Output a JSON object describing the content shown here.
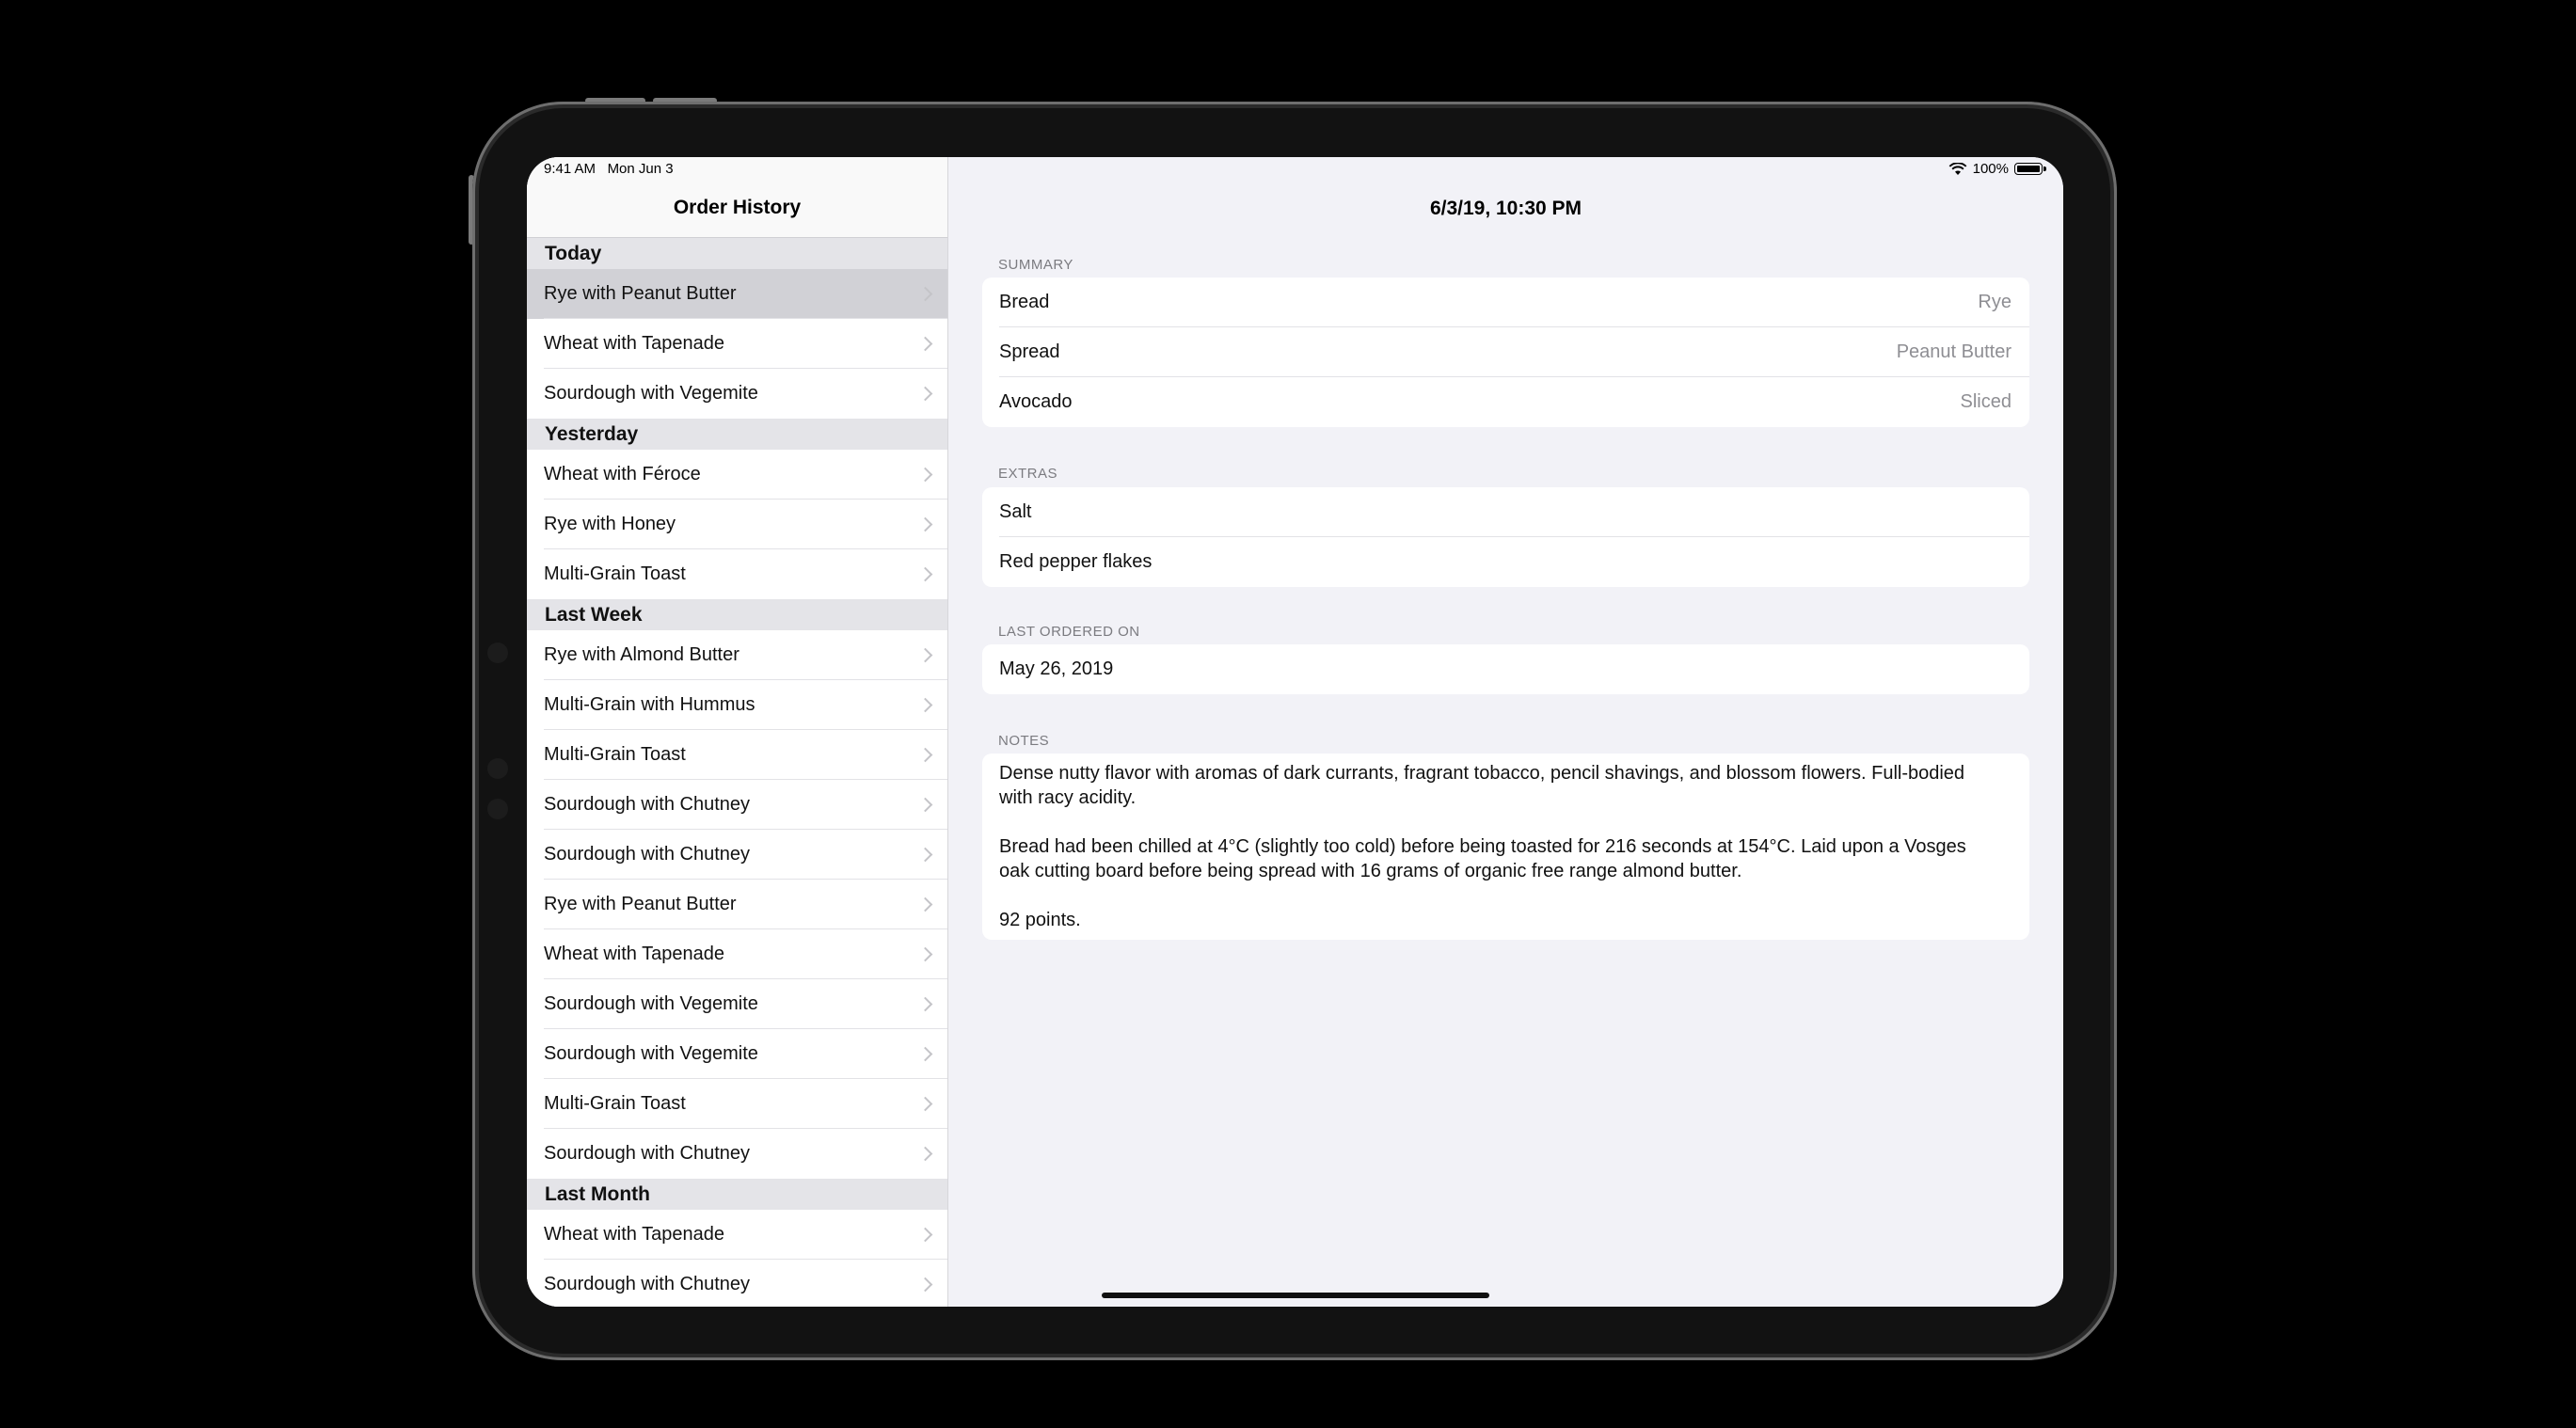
{
  "status": {
    "time": "9:41 AM",
    "date": "Mon Jun 3",
    "battery": "100%"
  },
  "sidebar": {
    "title": "Order History",
    "sections": [
      {
        "header": "Today",
        "items": [
          "Rye with Peanut Butter",
          "Wheat with Tapenade",
          "Sourdough with Vegemite"
        ]
      },
      {
        "header": "Yesterday",
        "items": [
          "Wheat with Féroce",
          "Rye with Honey",
          "Multi-Grain Toast"
        ]
      },
      {
        "header": "Last Week",
        "items": [
          "Rye with Almond Butter",
          "Multi-Grain with Hummus",
          "Multi-Grain Toast",
          "Sourdough with Chutney",
          "Sourdough with Chutney",
          "Rye with Peanut Butter",
          "Wheat with Tapenade",
          "Sourdough with Vegemite",
          "Sourdough with Vegemite",
          "Multi-Grain Toast",
          "Sourdough with Chutney"
        ]
      },
      {
        "header": "Last Month",
        "items": [
          "Wheat with Tapenade",
          "Sourdough with Chutney"
        ]
      }
    ],
    "selected": {
      "section": 0,
      "item": 0
    }
  },
  "detail": {
    "title": "6/3/19, 10:30 PM",
    "summary": {
      "label": "SUMMARY",
      "rows": [
        {
          "key": "Bread",
          "value": "Rye"
        },
        {
          "key": "Spread",
          "value": "Peanut Butter"
        },
        {
          "key": "Avocado",
          "value": "Sliced"
        }
      ]
    },
    "extras": {
      "label": "EXTRAS",
      "items": [
        "Salt",
        "Red pepper flakes"
      ]
    },
    "last_ordered": {
      "label": "LAST ORDERED ON",
      "value": "May 26, 2019"
    },
    "notes": {
      "label": "NOTES",
      "paragraphs": [
        "Dense nutty flavor with aromas of dark currants, fragrant tobacco, pencil shavings, and blossom flowers. Full-bodied with racy acidity.",
        "Bread had been chilled at 4°C (slightly too cold) before being toasted for 216 seconds at 154°C. Laid upon a Vosges oak cutting board before being spread with 16 grams of organic free range almond butter.",
        "92 points."
      ]
    }
  }
}
